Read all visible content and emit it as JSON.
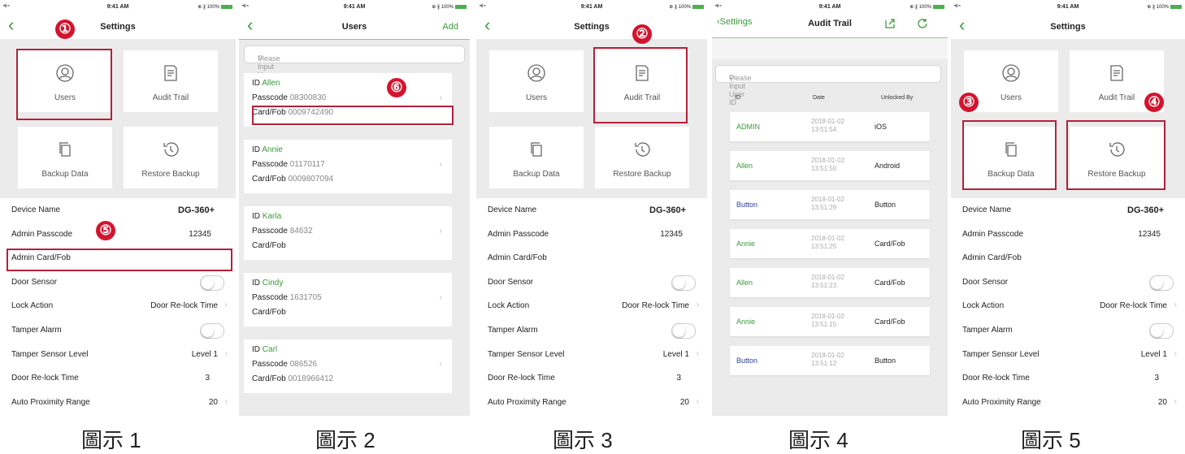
{
  "status_bar": {
    "signal": "•ıl ≈",
    "time": "9:41 AM",
    "battery": "⊕ ∦ 100%"
  },
  "colors": {
    "accent": "#3a9a3a",
    "marker": "#d4142e",
    "highlight_box": "#b3213a",
    "blue_text": "#2c3d9f"
  },
  "icons": {
    "back": "chevron-left-icon",
    "users": "user-circle-icon",
    "audit": "document-icon",
    "backup": "copy-icon",
    "restore": "history-icon",
    "share": "share-icon",
    "refresh": "refresh-icon",
    "search": "search-icon"
  },
  "tiles": {
    "users": "Users",
    "audit_trail": "Audit Trail",
    "backup": "Backup Data",
    "restore": "Restore Backup"
  },
  "settings_title": "Settings",
  "settings_rows": {
    "device_name": {
      "label": "Device Name",
      "value": "DG-360+"
    },
    "admin_passcode": {
      "label": "Admin Passcode",
      "value": "12345"
    },
    "admin_card": {
      "label": "Admin Card/Fob"
    },
    "door_sensor": {
      "label": "Door Sensor"
    },
    "lock_action": {
      "label": "Lock Action",
      "value": "Door Re-lock Time"
    },
    "tamper_alarm": {
      "label": "Tamper Alarm"
    },
    "tamper_level": {
      "label": "Tamper Sensor Level",
      "value": "Level 1"
    },
    "relock_time": {
      "label": "Door Re-lock Time",
      "value": "3"
    },
    "proximity": {
      "label": "Auto Proximity Range",
      "value": "20"
    }
  },
  "users_screen": {
    "title": "Users",
    "add": "Add",
    "search_placeholder": "Please Input User ID",
    "id_label": "ID",
    "passcode_label": "Passcode",
    "card_label": "Card/Fob",
    "users": [
      {
        "id": "Allen",
        "passcode": "08300830",
        "card": "0009742490"
      },
      {
        "id": "Annie",
        "passcode": "01170117",
        "card": "0009807094"
      },
      {
        "id": "Karla",
        "passcode": "84632",
        "card": ""
      },
      {
        "id": "Cindy",
        "passcode": "1631705",
        "card": ""
      },
      {
        "id": "Carl",
        "passcode": "086526",
        "card": "0018966412"
      }
    ]
  },
  "audit_screen": {
    "back_label": "Settings",
    "title": "Audit Trail",
    "search_placeholder": "Please Input User ID",
    "headers": {
      "id": "ID",
      "date": "Date",
      "unlocked_by": "Unlocked By"
    },
    "rows": [
      {
        "id": "ADMIN",
        "date": "2018-01-02",
        "time": "13:51:54",
        "by": "iOS",
        "style": "green"
      },
      {
        "id": "Allen",
        "date": "2018-01-02",
        "time": "13:51:50",
        "by": "Android",
        "style": "green"
      },
      {
        "id": "Button",
        "date": "2018-01-02",
        "time": "13:51:29",
        "by": "Button",
        "style": "blue"
      },
      {
        "id": "Annie",
        "date": "2018-01-02",
        "time": "13:51:25",
        "by": "Card/Fob",
        "style": "green"
      },
      {
        "id": "Allen",
        "date": "2018-01-02",
        "time": "13:51:23",
        "by": "Card/Fob",
        "style": "green"
      },
      {
        "id": "Annie",
        "date": "2018-01-02",
        "time": "13:51:15",
        "by": "Card/Fob",
        "style": "green"
      },
      {
        "id": "Button",
        "date": "2018-01-02",
        "time": "13:51:12",
        "by": "Button",
        "style": "blue"
      }
    ]
  },
  "markers": [
    "①",
    "②",
    "③",
    "④",
    "⑤",
    "⑥"
  ],
  "captions": [
    "圖示 1",
    "圖示 2",
    "圖示 3",
    "圖示 4",
    "圖示 5"
  ]
}
